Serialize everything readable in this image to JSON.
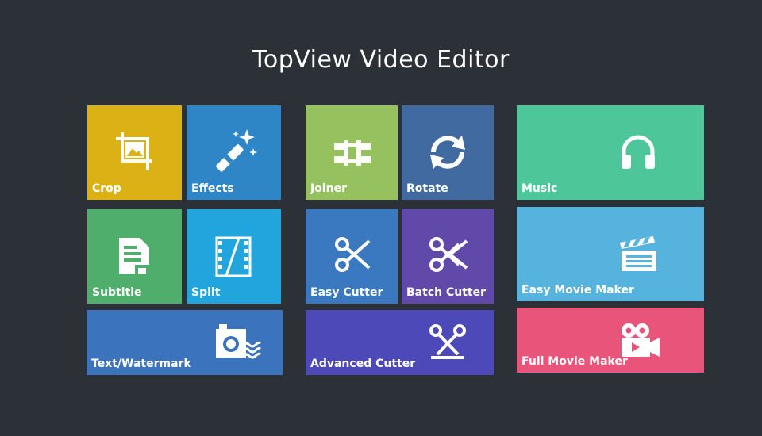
{
  "app": {
    "title": "TopView Video Editor"
  },
  "tiles": {
    "crop": {
      "label": "Crop",
      "color": "#dcb116",
      "icon": "crop-icon"
    },
    "effects": {
      "label": "Effects",
      "color": "#2f86c6",
      "icon": "magic-wand-icon"
    },
    "subtitle": {
      "label": "Subtitle",
      "color": "#4fae6b",
      "icon": "subtitle-icon"
    },
    "split": {
      "label": "Split",
      "color": "#22a5dc",
      "icon": "film-split-icon"
    },
    "text_watermark": {
      "label": "Text/Watermark",
      "color": "#3b74bd",
      "icon": "watermark-icon"
    },
    "joiner": {
      "label": "Joiner",
      "color": "#95c15e",
      "icon": "joiner-icon"
    },
    "rotate": {
      "label": "Rotate",
      "color": "#416aa0",
      "icon": "rotate-icon"
    },
    "easy_cutter": {
      "label": "Easy Cutter",
      "color": "#3a78c0",
      "icon": "scissors-icon"
    },
    "batch_cutter": {
      "label": "Batch Cutter",
      "color": "#6149aa",
      "icon": "batch-scissors-icon"
    },
    "advanced_cutter": {
      "label": "Advanced Cutter",
      "color": "#4d49b8",
      "icon": "advanced-scissors-icon"
    },
    "music": {
      "label": "Music",
      "color": "#4dc799",
      "icon": "headphones-icon"
    },
    "easy_movie_maker": {
      "label": "Easy Movie Maker",
      "color": "#55b3dd",
      "icon": "clapperboard-icon"
    },
    "full_movie_maker": {
      "label": "Full Movie Maker",
      "color": "#e9547a",
      "icon": "movie-camera-icon"
    }
  }
}
